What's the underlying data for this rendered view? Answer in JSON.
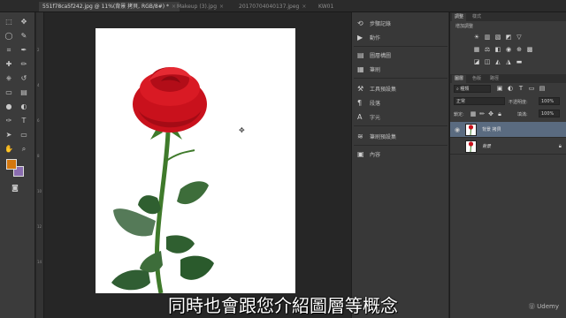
{
  "tabs": [
    {
      "label": "551f78ca5f242.jpg @ 11%(背景 拷貝, RGB/8#) *",
      "active": true
    },
    {
      "label": "Makeup (3).jpg",
      "active": false
    },
    {
      "label": "20170704040137.jpeg",
      "active": false
    },
    {
      "label": "KW01",
      "active": false
    }
  ],
  "dock": {
    "items": [
      "步驟記錄",
      "動作",
      "圖層構圖",
      "筆刷",
      "工具預設集",
      "段落",
      "字元",
      "筆刷預設集",
      "內容"
    ]
  },
  "panels": {
    "top_tabs": [
      "調整",
      "樣式"
    ],
    "adjust_title": "增加調整",
    "layer_tabs": [
      "圖層",
      "色版",
      "路徑"
    ],
    "filter_kind": "種類",
    "blend_mode": "正常",
    "opacity_label": "不透明度:",
    "opacity_value": "100%",
    "lock_label": "鎖定:",
    "fill_label": "填滿:",
    "fill_value": "100%",
    "layers": [
      {
        "name": "背景 拷貝",
        "selected": true
      },
      {
        "name": "背景",
        "selected": false
      }
    ]
  },
  "subtitle": "同時也會跟您介紹圖層等概念",
  "watermark": "Udemy",
  "colors": {
    "foreground": "#d4780f",
    "background": "#8a6db0"
  }
}
